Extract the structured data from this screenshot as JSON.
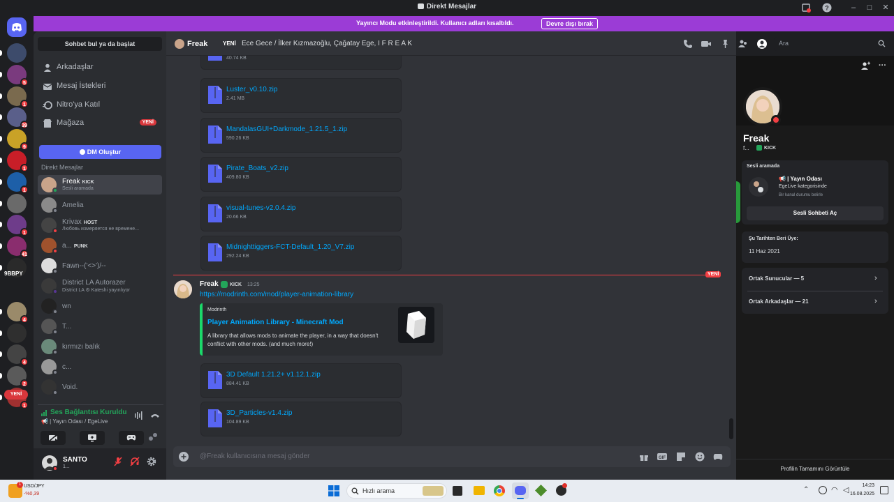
{
  "window": {
    "title": "Direkt Mesajlar"
  },
  "banner": {
    "message": "Yayıncı Modu etkinleştirildi. Kullanıcı adları kısaltıldı.",
    "button_label": "Devre dışı bırak",
    "color": "#9b3cd6"
  },
  "rail": {
    "servers": [
      {
        "badge": ""
      },
      {
        "badge": "5"
      },
      {
        "badge": "1"
      },
      {
        "badge": "39"
      },
      {
        "badge": "9"
      },
      {
        "badge": "1"
      },
      {
        "badge": "1"
      },
      {
        "badge": ""
      },
      {
        "badge": "1"
      },
      {
        "badge": "41"
      },
      {
        "badge": ""
      },
      {
        "badge": "4"
      },
      {
        "badge": ""
      },
      {
        "badge": "4"
      },
      {
        "badge": "2"
      },
      {
        "badge": "1"
      }
    ],
    "server_9bbpy_label": "9BBPY",
    "new_label": "YENİ"
  },
  "sidebar": {
    "search_label": "Sohbet bul ya da başlat",
    "nav": [
      {
        "label": "Arkadaşlar",
        "icon": "friends-icon"
      },
      {
        "label": "Mesaj İstekleri",
        "icon": "envelope-icon"
      },
      {
        "label": "Nitro'ya Katıl",
        "icon": "nitro-icon"
      },
      {
        "label": "Mağaza",
        "icon": "shop-icon",
        "badge": "YENİ"
      }
    ],
    "dm_create_label": "DM Oluştur",
    "dm_header": "Direkt Mesajlar",
    "dms": [
      {
        "name": "Freak",
        "tag": "KICK",
        "sub": "Sesli aramada",
        "status": "#23a55a"
      },
      {
        "name": "Amelia",
        "tag": "",
        "sub": "",
        "status": "#80848e"
      },
      {
        "name": "Krivax",
        "tag": "HOST",
        "sub": "Любовь измеряется не времене...",
        "status": "#f23f43"
      },
      {
        "name": "a...",
        "tag": "PUNK",
        "sub": "",
        "status": "#f23f43"
      },
      {
        "name": "Fawn--('<>')/--",
        "tag": "",
        "sub": "",
        "status": "#80848e"
      },
      {
        "name": "District LA Autorazer",
        "tag": "",
        "sub": "District LA ⚙ Kateshi yayınlıyor",
        "status": "#593695"
      },
      {
        "name": "wn",
        "tag": "",
        "sub": "",
        "status": "#80848e"
      },
      {
        "name": "T...",
        "tag": "",
        "sub": "",
        "status": "#80848e"
      },
      {
        "name": "kırmızı balık",
        "tag": "",
        "sub": "",
        "status": "#80848e"
      },
      {
        "name": "c...",
        "tag": "",
        "sub": "",
        "status": "#80848e"
      },
      {
        "name": "Void.",
        "tag": "",
        "sub": "",
        "status": "#80848e"
      }
    ],
    "voice": {
      "status": "Ses Bağlantısı Kuruldu",
      "channel": "📢 | Yayın Odası / EgeLive"
    },
    "user": {
      "name": "SANTO",
      "sub": "1..."
    }
  },
  "chat": {
    "recipient": "Freak",
    "new_label": "YENİ",
    "group_title": "Ece Gece / İlker Kızmazoğlu, Çağatay Ege, I F R E A K",
    "search_placeholder": "Ara",
    "top_file_size": "40.74 KB",
    "files_top": [
      {
        "name": "Luster_v0.10.zip",
        "size": "2.41 MB"
      },
      {
        "name": "MandalasGUI+Darkmode_1.21.5_1.zip",
        "size": "590.26 KB"
      },
      {
        "name": "Pirate_Boats_v2.zip",
        "size": "409.80 KB"
      },
      {
        "name": "visual-tunes-v2.0.4.zip",
        "size": "20.66 KB"
      },
      {
        "name": "Midnighttiggers-FCT-Default_1.20_V7.zip",
        "size": "292.24 KB"
      }
    ],
    "message": {
      "author": "Freak",
      "tag": "KICK",
      "time": "13:25",
      "link": "https://modrinth.com/mod/player-animation-library",
      "embed": {
        "provider": "Modrinth",
        "title": "Player Animation Library - Minecraft Mod",
        "description": "A library that allows mods to animate the player, in a way that doesn't conflict with other mods. (and much more!)"
      }
    },
    "files_bottom": [
      {
        "name": "3D Default 1.21.2+ v1.12.1.zip",
        "size": "884.41 KB"
      },
      {
        "name": "3D_Particles-v1.4.zip",
        "size": "104.89 KB"
      }
    ],
    "composer_placeholder": "@Freak kullanıcısına mesaj gönder"
  },
  "profile": {
    "name": "Freak",
    "sub": "f...",
    "tag": "KICK",
    "voice_section": "Sesli aramada",
    "voice_channel": "📢 | Yayın Odası",
    "voice_category": "EgeLive kategorisinde",
    "voice_status": "Bir kanal durumu belirle",
    "open_voice_label": "Sesli Sohbeti Aç",
    "member_since_label": "Şu Tarihten Beri Üye:",
    "member_since": "11 Haz 2021",
    "mutual_servers": "Ortak Sunucular — 5",
    "mutual_friends": "Ortak Arkadaşlar — 21",
    "view_full": "Profilin Tamamını Görüntüle"
  },
  "taskbar": {
    "stock_name": "USD/JPY",
    "stock_change": "-%0,39",
    "search_label": "Hızlı arama",
    "time": "14:23",
    "date": "16.08.2025"
  }
}
